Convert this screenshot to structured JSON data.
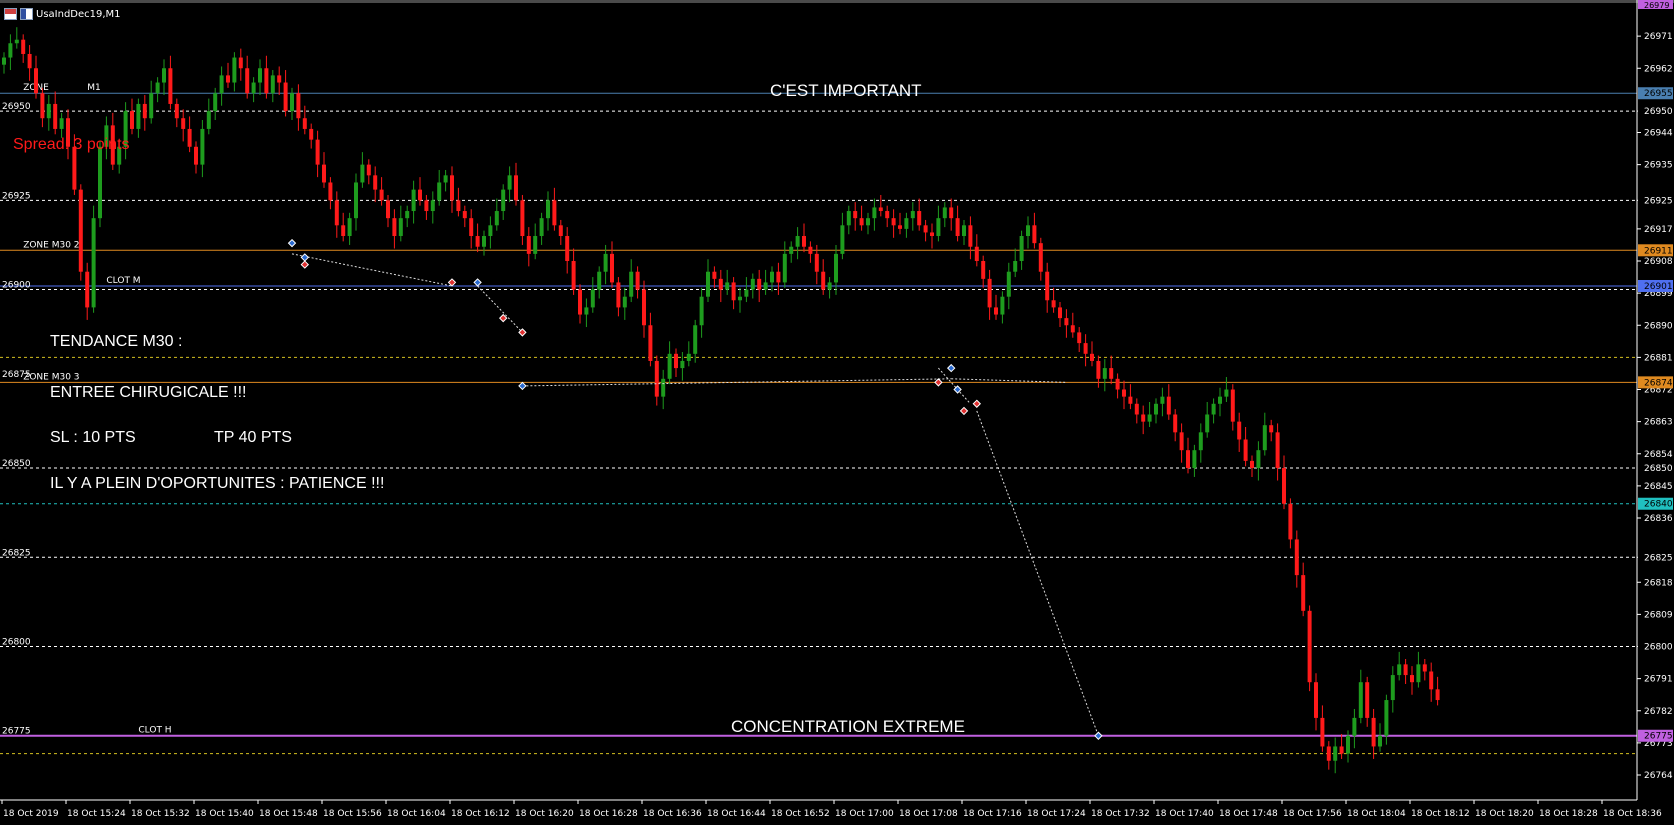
{
  "window": {
    "title": "UsaIndDec19,M1"
  },
  "spread_text": "Spread: 3 points",
  "colors": {
    "bull": "#1e9c1e",
    "bear": "#ff1a1a",
    "doji": "#ffffff",
    "background": "#000000",
    "grid_text": "#ffffff"
  },
  "chart_data": {
    "type": "candlestick",
    "symbol": "UsaIndDec19",
    "timeframe": "M1",
    "ylim": [
      26757,
      26980
    ],
    "price_ticks": [
      "26971",
      "26962",
      "26950",
      "26944",
      "26935",
      "26925",
      "26917",
      "26908",
      "26899",
      "26890",
      "26881",
      "26872",
      "26863",
      "26854",
      "26845",
      "26836",
      "26825",
      "26818",
      "26809",
      "26800",
      "26791",
      "26782",
      "26773",
      "26764"
    ],
    "time_ticks": [
      "18 Oct 2019",
      "18 Oct 15:24",
      "18 Oct 15:32",
      "18 Oct 15:40",
      "18 Oct 15:48",
      "18 Oct 15:56",
      "18 Oct 16:04",
      "18 Oct 16:12",
      "18 Oct 16:20",
      "18 Oct 16:28",
      "18 Oct 16:36",
      "18 Oct 16:44",
      "18 Oct 16:52",
      "18 Oct 17:00",
      "18 Oct 17:08",
      "18 Oct 17:16",
      "18 Oct 17:24",
      "18 Oct 17:32",
      "18 Oct 17:40",
      "18 Oct 17:48",
      "18 Oct 17:56",
      "18 Oct 18:04",
      "18 Oct 18:12",
      "18 Oct 18:20",
      "18 Oct 18:28",
      "18 Oct 18:36"
    ],
    "closes": [
      26965,
      26969,
      26970,
      26966,
      26962,
      26955,
      26948,
      26952,
      26945,
      26948,
      26940,
      26928,
      26905,
      26895,
      26920,
      26940,
      26946,
      26935,
      26940,
      26950,
      26945,
      26952,
      26948,
      26955,
      26958,
      26962,
      26952,
      26948,
      26945,
      26940,
      26935,
      26945,
      26950,
      26955,
      26960,
      26958,
      26965,
      26962,
      26955,
      26958,
      26962,
      26955,
      26960,
      26958,
      26950,
      26955,
      26948,
      26945,
      26942,
      26935,
      26930,
      26925,
      26918,
      26915,
      26920,
      26930,
      26935,
      26932,
      26928,
      26925,
      26920,
      26915,
      26920,
      26922,
      26928,
      26925,
      26922,
      26925,
      26930,
      26932,
      26925,
      26922,
      26920,
      26915,
      26912,
      26915,
      26918,
      26922,
      26928,
      26932,
      26925,
      26915,
      26910,
      26915,
      26920,
      26925,
      26918,
      26915,
      26908,
      26900,
      26893,
      26895,
      26900,
      26905,
      26910,
      26902,
      26895,
      26898,
      26905,
      26900,
      26890,
      26880,
      26870,
      26875,
      26882,
      26878,
      26880,
      26882,
      26890,
      26898,
      26905,
      26903,
      26900,
      26902,
      26897,
      26898,
      26900,
      26903,
      26900,
      26902,
      26905,
      26902,
      26910,
      26912,
      26915,
      26912,
      26910,
      26905,
      26900,
      26902,
      26910,
      26918,
      26922,
      26920,
      26918,
      26920,
      26923,
      26922,
      26920,
      26918,
      26917,
      26920,
      26922,
      26918,
      26916,
      26915,
      26920,
      26923,
      26920,
      26915,
      26918,
      26912,
      26908,
      26903,
      26895,
      26893,
      26898,
      26905,
      26908,
      26915,
      26918,
      26913,
      26905,
      26897,
      26895,
      26892,
      26890,
      26888,
      26885,
      26882,
      26880,
      26875,
      26878,
      26875,
      26872,
      26870,
      26868,
      26865,
      26863,
      26865,
      26868,
      26870,
      26865,
      26860,
      26855,
      26850,
      26855,
      26860,
      26865,
      26868,
      26870,
      26872,
      26863,
      26858,
      26852,
      26850,
      26855,
      26862,
      26860,
      26850,
      26840,
      26830,
      26820,
      26810,
      26790,
      26780,
      26772,
      26768,
      26772,
      26770,
      26775,
      26780,
      26790,
      26780,
      26772,
      26775,
      26785,
      26792,
      26795,
      26792,
      26790,
      26795,
      26793,
      26788,
      26785
    ],
    "horizontal_levels": [
      {
        "price": 26955,
        "color": "#4a7fb0",
        "style": "solid",
        "badge": "26955"
      },
      {
        "price": 26950,
        "color": "#ffffff",
        "style": "dashed",
        "badge": "26950"
      },
      {
        "price": 26925,
        "color": "#ffffff",
        "style": "dashed",
        "badge": "26925"
      },
      {
        "price": 26911,
        "color": "#e08a20",
        "style": "solid",
        "badge": "26911"
      },
      {
        "price": 26901,
        "color": "#4f6ff0",
        "style": "solid",
        "badge": "26901"
      },
      {
        "price": 26900,
        "color": "#ffffff",
        "style": "dashed",
        "badge": ""
      },
      {
        "price": 26881,
        "color": "#d4c020",
        "style": "dashed",
        "badge": ""
      },
      {
        "price": 26874,
        "color": "#e08a20",
        "style": "solid",
        "badge": "26874"
      },
      {
        "price": 26850,
        "color": "#ffffff",
        "style": "dashed",
        "badge": "26850"
      },
      {
        "price": 26840,
        "color": "#20c0c0",
        "style": "dashed",
        "badge": "26840"
      },
      {
        "price": 26825,
        "color": "#ffffff",
        "style": "dashed",
        "badge": "26825"
      },
      {
        "price": 26800,
        "color": "#ffffff",
        "style": "dashed",
        "badge": "26800"
      },
      {
        "price": 26775,
        "color": "#c060e0",
        "style": "solid",
        "badge": "26775"
      },
      {
        "price": 26770,
        "color": "#d4c020",
        "style": "dashed",
        "badge": ""
      }
    ],
    "level_labels": [
      {
        "text": "26950",
        "price": 26950
      },
      {
        "text": "26925",
        "price": 26925
      },
      {
        "text": "26900",
        "price": 26900
      },
      {
        "text": "26875",
        "price": 26875
      },
      {
        "text": "26850",
        "price": 26850
      },
      {
        "text": "26825",
        "price": 26825
      },
      {
        "text": "26800",
        "price": 26800
      },
      {
        "text": "26775",
        "price": 26775
      }
    ],
    "top_badge": "26979",
    "zone_labels": [
      {
        "text": "ZONE",
        "price": 26955,
        "bar": 3
      },
      {
        "text": "M1",
        "price": 26955,
        "bar": 13
      },
      {
        "text": "ZONE M30 2",
        "price": 26911,
        "bar": 3
      },
      {
        "text": "CLOT M",
        "price": 26901,
        "bar": 16
      },
      {
        "text": "ZONE M30 3",
        "price": 26874,
        "bar": 3
      },
      {
        "text": "CLOT H",
        "price": 26775,
        "bar": 21
      }
    ],
    "trade_lines": [
      {
        "from": [
          45,
          26910
        ],
        "to": [
          70,
          26901
        ]
      },
      {
        "from": [
          74,
          26901
        ],
        "to": [
          81,
          26888
        ]
      },
      {
        "from": [
          81,
          26873
        ],
        "to": [
          148,
          26875
        ]
      },
      {
        "from": [
          148,
          26875
        ],
        "to": [
          166,
          26874
        ]
      },
      {
        "from": [
          146,
          26878
        ],
        "to": [
          151,
          26868
        ]
      },
      {
        "from": [
          152,
          26866
        ],
        "to": [
          171,
          26775
        ]
      }
    ],
    "trade_markers": [
      {
        "bar": 45,
        "price": 26913,
        "kind": "buy"
      },
      {
        "bar": 47,
        "price": 26909,
        "kind": "buy"
      },
      {
        "bar": 47,
        "price": 26907,
        "kind": "sell"
      },
      {
        "bar": 70,
        "price": 26902,
        "kind": "sell"
      },
      {
        "bar": 74,
        "price": 26902,
        "kind": "buy"
      },
      {
        "bar": 78,
        "price": 26892,
        "kind": "sell"
      },
      {
        "bar": 81,
        "price": 26888,
        "kind": "sell"
      },
      {
        "bar": 81,
        "price": 26873,
        "kind": "buy"
      },
      {
        "bar": 146,
        "price": 26874,
        "kind": "sell"
      },
      {
        "bar": 148,
        "price": 26878,
        "kind": "buy"
      },
      {
        "bar": 149,
        "price": 26872,
        "kind": "buy"
      },
      {
        "bar": 150,
        "price": 26866,
        "kind": "sell"
      },
      {
        "bar": 152,
        "price": 26868,
        "kind": "sell"
      },
      {
        "bar": 171,
        "price": 26775,
        "kind": "buy"
      }
    ]
  },
  "annotations": {
    "important": "C'EST IMPORTANT",
    "tendance": "TENDANCE M30 :",
    "entree": "ENTREE CHIRUGICALE !!!",
    "sl": "SL : 10 PTS",
    "tp": "TP 40 PTS",
    "patience": "IL Y A PLEIN D'OPORTUNITES : PATIENCE !!!",
    "concentration": "CONCENTRATION EXTREME"
  }
}
